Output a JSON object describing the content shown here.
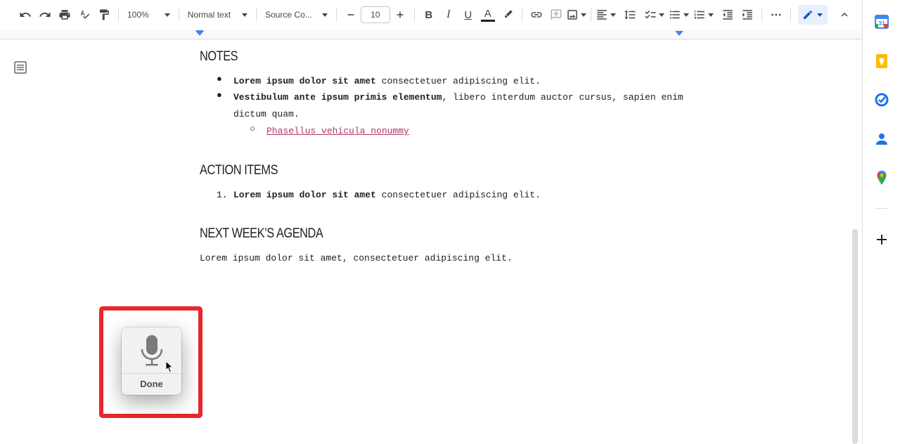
{
  "toolbar": {
    "zoom": "100%",
    "style": "Normal text",
    "font": "Source Co...",
    "font_size": "10",
    "bold": "B",
    "italic": "I",
    "underline": "U",
    "text_color": "A",
    "more": "⋯"
  },
  "document": {
    "notes_heading": "NOTES",
    "notes_item1_bold": "Lorem ipsum dolor sit amet",
    "notes_item1_rest": " consectetuer adipiscing elit.",
    "notes_item2_bold": "Vestibulum ante ipsum primis elementum",
    "notes_item2_rest": ", libero interdum auctor cursus, sapien enim",
    "notes_item2_cont": "dictum quam.",
    "notes_subitem_link": "Phasellus vehicula nonummy",
    "action_heading": "ACTION ITEMS",
    "action_item1_number": "1.",
    "action_item1_bold": "Lorem ipsum dolor sit amet",
    "action_item1_rest": " consectetuer adipiscing elit.",
    "agenda_heading": "NEXT WEEK’S AGENDA",
    "agenda_text": "Lorem ipsum dolor sit amet, consectetuer adipiscing elit."
  },
  "dictation": {
    "done_label": "Done"
  },
  "colors": {
    "highlight_box": "#e8262b",
    "link": "#b1366c",
    "ruler_marker": "#4a86e8"
  },
  "sidebar": {
    "calendar_day": "31"
  }
}
